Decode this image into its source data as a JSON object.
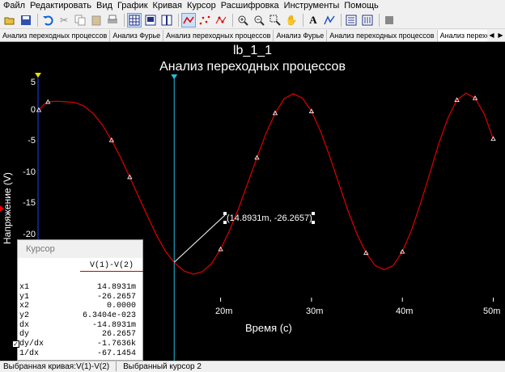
{
  "menu": [
    "Файл",
    "Редактировать",
    "Вид",
    "График",
    "Кривая",
    "Курсор",
    "Расшифровка",
    "Инструменты",
    "Помощь"
  ],
  "toolbar_icons": [
    "open-icon",
    "save-icon",
    "undo-icon",
    "cut-icon",
    "copy-icon",
    "paste-icon",
    "print-icon",
    "grid-icon",
    "legend-icon",
    "cursor-icon",
    "show-line-icon",
    "show-points-icon",
    "show-both-icon",
    "zoom-in-icon",
    "zoom-out-icon",
    "zoom-area-icon",
    "pan-icon",
    "text-icon",
    "color-icon",
    "export-icon",
    "import-icon",
    "stop-icon"
  ],
  "tabs": [
    "Анализ переходных процессов",
    "Анализ Фурье",
    "Анализ переходных процессов",
    "Анализ Фурье",
    "Анализ переходных процессов",
    "Анализ переходны"
  ],
  "selected_tab_index": 5,
  "plot": {
    "title": "lb_1_1",
    "subtitle": "Анализ переходных процессов",
    "cursor_label": "(14.8931m, -26.2657)"
  },
  "chart_data": {
    "type": "line",
    "xlabel": "Время (с)",
    "ylabel": "Напряжение (V)",
    "x_ticks": [
      "20m",
      "30m",
      "40m",
      "50m"
    ],
    "y_ticks": [
      "5",
      "0",
      "-5",
      "-10",
      "-15",
      "-20"
    ],
    "xlim": [
      0,
      50
    ],
    "ylim": [
      -30,
      5
    ],
    "series": [
      {
        "name": "V(1)-V(2)",
        "color": "#e00000",
        "x": [
          0,
          0.5,
          1,
          2,
          3,
          4,
          5,
          6,
          7,
          8,
          9,
          10,
          11,
          12,
          13,
          14,
          15,
          16,
          17,
          18,
          19,
          20,
          21,
          22,
          23,
          24,
          25,
          26,
          27,
          28,
          29,
          30,
          31,
          32,
          33,
          34,
          35,
          36,
          37,
          38,
          39,
          40,
          41,
          42,
          43,
          44,
          45,
          46,
          47,
          48,
          49,
          50
        ],
        "y": [
          0,
          0.8,
          1.3,
          1.4,
          1.3,
          1.2,
          0.6,
          -0.6,
          -2.4,
          -4.8,
          -7.6,
          -10.7,
          -13.9,
          -17.1,
          -20.1,
          -22.7,
          -24.5,
          -25.7,
          -26.2,
          -25.8,
          -24.5,
          -22.2,
          -19.2,
          -15.6,
          -11.6,
          -7.6,
          -3.7,
          -0.5,
          1.8,
          2.6,
          1.9,
          -0.2,
          -3.4,
          -7.4,
          -11.7,
          -16,
          -19.8,
          -22.8,
          -24.8,
          -25.5,
          -24.8,
          -22.6,
          -19.2,
          -14.9,
          -10.2,
          -5.4,
          -1.3,
          1.6,
          2.7,
          1.9,
          -0.6,
          -4.6
        ]
      }
    ],
    "markers_x": [
      0,
      1,
      8,
      10,
      20,
      24,
      26,
      30,
      36,
      40,
      46,
      48,
      50
    ],
    "cursor1_x": 14.8931,
    "grid": false
  },
  "cursor_panel": {
    "title": "Курсор",
    "header": "V(1)-V(2)",
    "rows": [
      {
        "k": "x1",
        "v": "14.8931m"
      },
      {
        "k": "y1",
        "v": "-26.2657"
      },
      {
        "k": "x2",
        "v": "0.0000"
      },
      {
        "k": "y2",
        "v": "6.3404e-023"
      },
      {
        "k": "dx",
        "v": "-14.8931m"
      },
      {
        "k": "dy",
        "v": "26.2657"
      },
      {
        "k": "dy/dx",
        "v": "-1.7636k"
      },
      {
        "k": "1/dx",
        "v": "-67.1454"
      }
    ]
  },
  "status": {
    "left": "Выбранная кривая:V(1)-V(2)",
    "right": "Выбранный курсор 2"
  }
}
